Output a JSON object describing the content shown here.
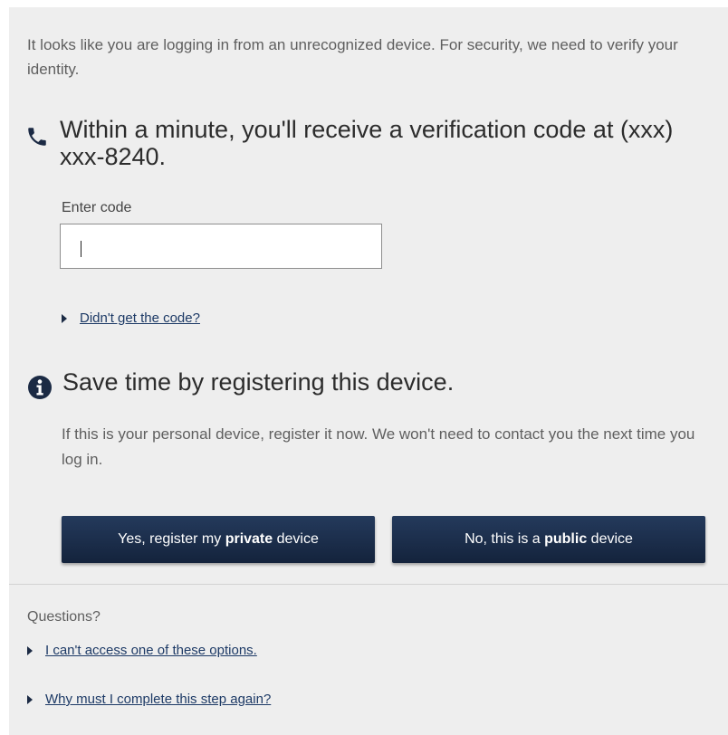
{
  "intro_text": "It looks like you are logging in from an unrecognized device. For security, we need to verify your identity.",
  "verification": {
    "heading": "Within a minute, you'll receive a verification code at (xxx) xxx-8240.",
    "code_label": "Enter code",
    "code_value": "",
    "didnt_get_code_link": "Didn't get the code?"
  },
  "register": {
    "heading": "Save time by registering this device.",
    "description": "If this is your personal device, register it now. We won't need to contact you the next time you log in.",
    "yes_button": {
      "prefix": "Yes, register my ",
      "bold": "private",
      "suffix": " device"
    },
    "no_button": {
      "prefix": "No, this is a ",
      "bold": "public",
      "suffix": " device"
    }
  },
  "help": {
    "title": "Questions?",
    "links": [
      "I can't access one of these options.",
      "Why must I complete this step again?"
    ]
  },
  "colors": {
    "button": "#1b2d4c",
    "link": "#1d3a66",
    "panel": "#eeeeee"
  },
  "icons": {
    "phone": "phone-icon",
    "info": "info-icon",
    "expand": "triangle-right-icon"
  }
}
